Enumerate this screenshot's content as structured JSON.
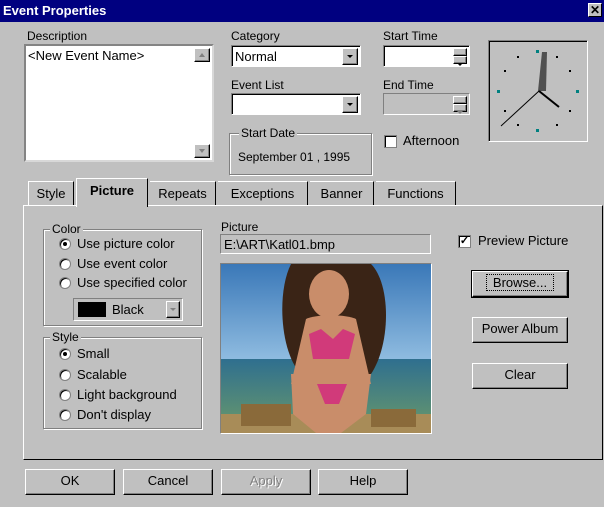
{
  "window": {
    "title": "Event Properties",
    "close_glyph": "✕"
  },
  "description": {
    "label": "Description",
    "value": "<New  Event Name>"
  },
  "category": {
    "label": "Category",
    "value": "Normal"
  },
  "event_list": {
    "label": "Event List",
    "value": ""
  },
  "start_time": {
    "label": "Start Time",
    "value": ""
  },
  "end_time": {
    "label": "End Time",
    "value": ""
  },
  "start_date": {
    "label": "Start Date",
    "value": "September  01 , 1995"
  },
  "afternoon": {
    "label": "Afternoon",
    "checked": false
  },
  "tabs": [
    {
      "label": "Style"
    },
    {
      "label": "Picture"
    },
    {
      "label": "Repeats"
    },
    {
      "label": "Exceptions"
    },
    {
      "label": "Banner"
    },
    {
      "label": "Functions"
    }
  ],
  "active_tab": "Picture",
  "color_group": {
    "label": "Color",
    "options": [
      {
        "label": "Use picture color",
        "selected": true
      },
      {
        "label": "Use event color",
        "selected": false
      },
      {
        "label": "Use specified color",
        "selected": false
      }
    ],
    "color_select": {
      "value": "Black",
      "swatch": "#000000"
    }
  },
  "style_group": {
    "label": "Style",
    "options": [
      {
        "label": "Small",
        "selected": true
      },
      {
        "label": "Scalable",
        "selected": false
      },
      {
        "label": "Light background",
        "selected": false
      },
      {
        "label": "Don't display",
        "selected": false
      }
    ]
  },
  "picture": {
    "label": "Picture",
    "path": "E:\\ART\\Katl01.bmp"
  },
  "preview": {
    "label": "Preview Picture",
    "checked": true
  },
  "side_buttons": {
    "browse": "Browse...",
    "power_album": "Power Album",
    "clear": "Clear"
  },
  "footer": {
    "ok": "OK",
    "cancel": "Cancel",
    "apply": "Apply",
    "help": "Help"
  },
  "colors": {
    "title_bar": "#000080",
    "face": "#c0c0c0",
    "clock_face": "#008080"
  }
}
